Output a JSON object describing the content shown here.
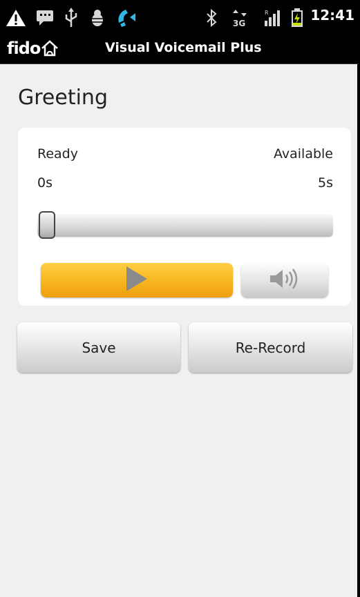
{
  "status_bar": {
    "time": "12:41",
    "icons": [
      "warning-icon",
      "chat-icon",
      "usb-icon",
      "android-debug-icon",
      "phone-call-icon",
      "bluetooth-icon",
      "3g-data-icon",
      "signal-icon",
      "battery-charging-icon"
    ]
  },
  "title_bar": {
    "logo": "fido",
    "title": "Visual Voicemail Plus"
  },
  "page": {
    "heading": "Greeting"
  },
  "player": {
    "status_label": "Ready",
    "available_label": "Available",
    "elapsed": "0s",
    "duration": "5s",
    "progress": 0.0
  },
  "actions": {
    "save_label": "Save",
    "rerecord_label": "Re-Record"
  },
  "colors": {
    "play_button": "#f7b51e",
    "background": "#f0f0f0",
    "card": "#ffffff"
  }
}
